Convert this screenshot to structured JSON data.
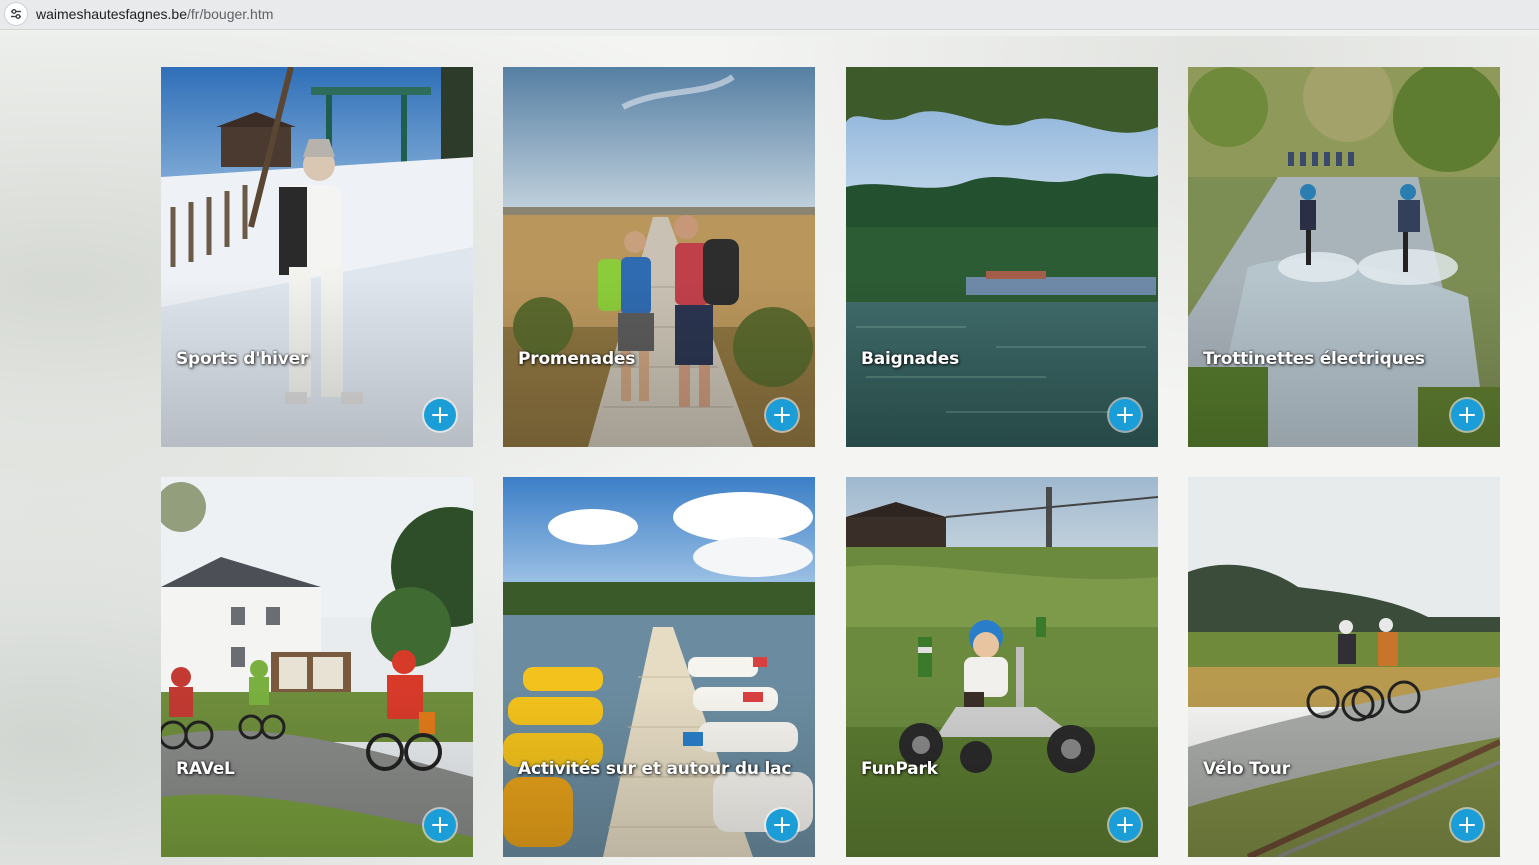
{
  "browser": {
    "url_domain": "waimeshautesfagnes.be",
    "url_path": "/fr/bouger.htm",
    "site_info_icon": "tune-icon"
  },
  "tiles": [
    {
      "label": "Sports d'hiver",
      "button_icon": "plus-icon",
      "button_color": "#1b9ed8"
    },
    {
      "label": "Promenades",
      "button_icon": "plus-icon",
      "button_color": "#1b9ed8"
    },
    {
      "label": "Baignades",
      "button_icon": "plus-icon",
      "button_color": "#1b9ed8"
    },
    {
      "label": "Trottinettes électriques",
      "button_icon": "plus-icon",
      "button_color": "#1b9ed8"
    },
    {
      "label": "RAVeL",
      "button_icon": "plus-icon",
      "button_color": "#1b9ed8"
    },
    {
      "label": "Activités sur et autour du lac",
      "button_icon": "plus-icon",
      "button_color": "#1b9ed8"
    },
    {
      "label": "FunPark",
      "button_icon": "plus-icon",
      "button_color": "#1b9ed8"
    },
    {
      "label": "Vélo Tour",
      "button_icon": "plus-icon",
      "button_color": "#1b9ed8"
    }
  ]
}
